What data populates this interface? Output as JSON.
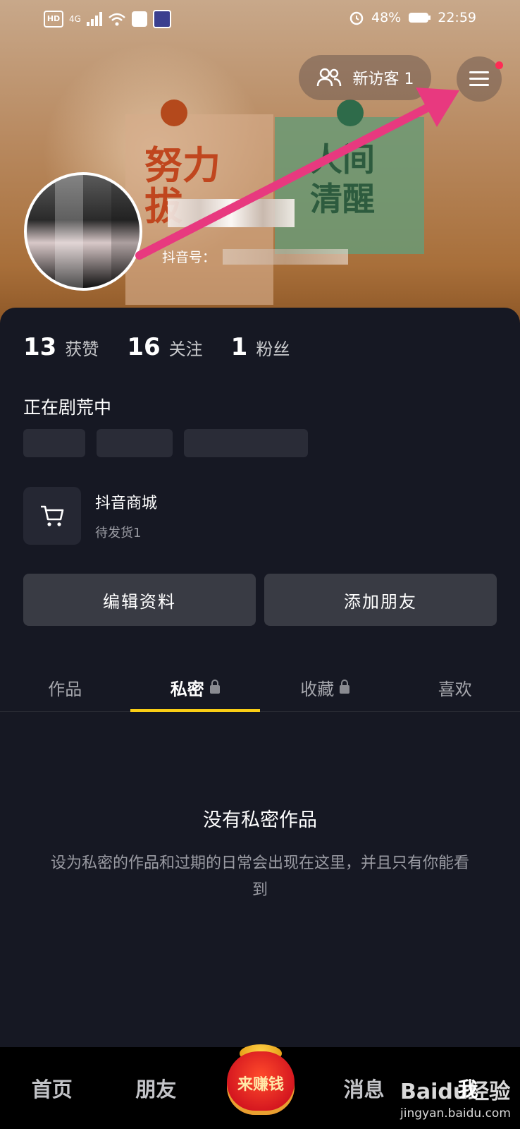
{
  "status_bar": {
    "network": "HD",
    "signal": "4G",
    "battery": "48%",
    "time": "22:59"
  },
  "header": {
    "visitor_label": "新访客 1",
    "menu_icon": "hamburger-menu-icon",
    "menu_has_notification": true
  },
  "profile": {
    "id_label": "抖音号：",
    "stats": [
      {
        "num": "13",
        "label": "获赞"
      },
      {
        "num": "16",
        "label": "关注"
      },
      {
        "num": "1",
        "label": "粉丝"
      }
    ],
    "bio": "正在剧荒中"
  },
  "shop": {
    "title": "抖音商城",
    "subtitle": "待发货1"
  },
  "actions": {
    "edit": "编辑资料",
    "add_friend": "添加朋友"
  },
  "tabs": [
    {
      "label": "作品",
      "locked": false,
      "active": false
    },
    {
      "label": "私密",
      "locked": true,
      "active": true
    },
    {
      "label": "收藏",
      "locked": true,
      "active": false
    },
    {
      "label": "喜欢",
      "locked": false,
      "active": false
    }
  ],
  "empty_state": {
    "title": "没有私密作品",
    "description": "设为私密的作品和过期的日常会出现在这里，并且只有你能看到"
  },
  "bottom_nav": {
    "home": "首页",
    "friends": "朋友",
    "earn": "来赚钱",
    "messages": "消息",
    "me": "我"
  },
  "watermark": {
    "brand": "Baidu经验",
    "url": "jingyan.baidu.com"
  },
  "colors": {
    "accent": "#face15",
    "background": "#161823",
    "arrow": "#e8397f"
  }
}
